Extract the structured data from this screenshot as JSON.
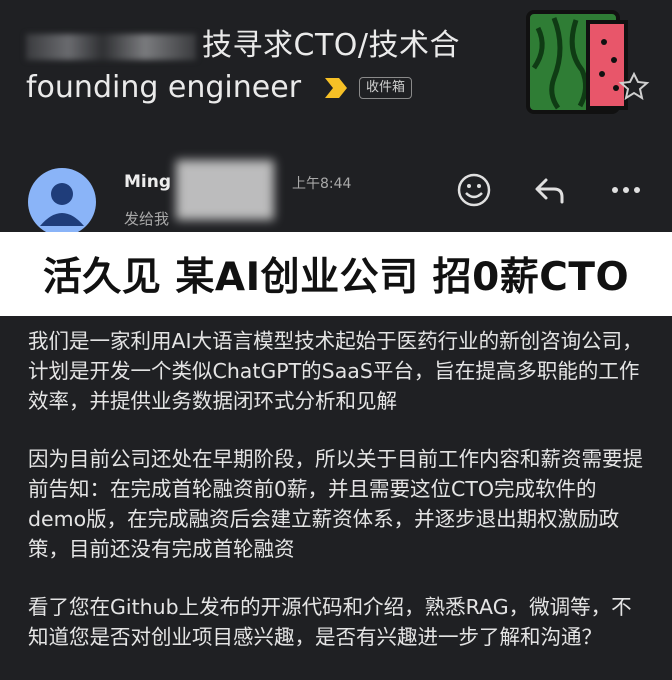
{
  "email": {
    "subject_line1": "技寻求CTO/技术合",
    "subject_line2": "founding engineer",
    "label_chip": "收件箱",
    "sender_name": "Ming",
    "time": "上午8:44",
    "recipient": "发给我"
  },
  "actions": [
    {
      "icon": "emoji-icon"
    },
    {
      "icon": "reply-icon"
    },
    {
      "icon": "more-icon"
    }
  ],
  "banner": {
    "text": "活久见 某AI创业公司 招0薪CTO"
  },
  "body": {
    "paragraphs": [
      "我们是一家利用AI大语言模型技术起始于医药行业的新创咨询公司，计划是开发一个类似ChatGPT的SaaS平台，旨在提高多职能的工作效率，并提供业务数据闭环式分析和见解",
      "因为目前公司还处在早期阶段，所以关于目前工作内容和薪资需要提前告知：在完成首轮融资前0薪，并且需要这位CTO完成软件的demo版，在完成融资后会建立薪资体系，并逐步退出期权激励政策，目前还没有完成首轮融资",
      "看了您在Github上发布的开源代码和介绍，熟悉RAG，微调等，不知道您是否对创业项目感兴趣，是否有兴趣进一步了解和沟通？"
    ]
  },
  "colors": {
    "background": "#1f2023",
    "banner": "#ffffff",
    "important_marker": "#f6c026",
    "avatar": "#8ab4f8"
  }
}
